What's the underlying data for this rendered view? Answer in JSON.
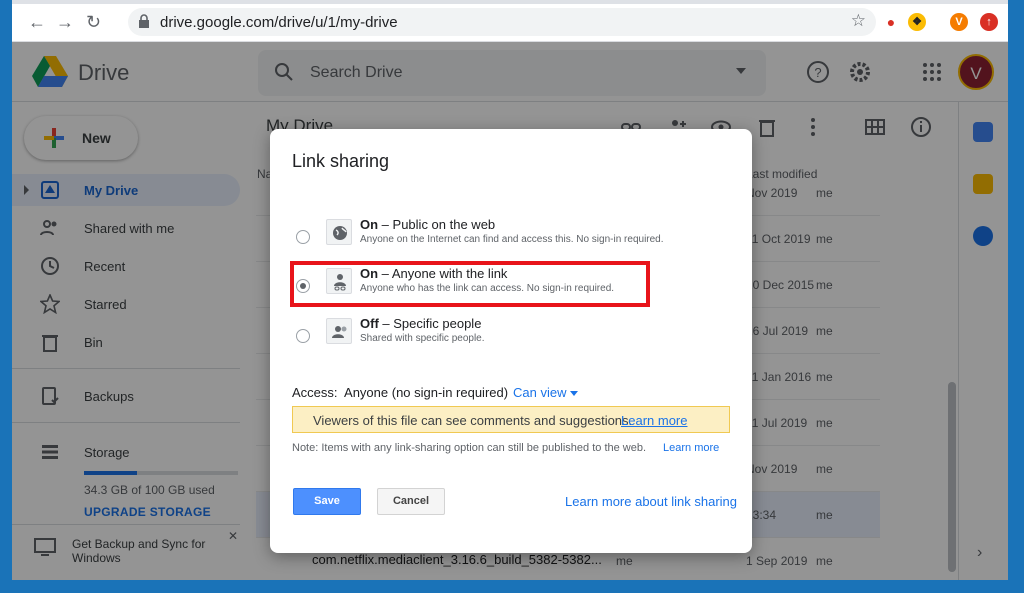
{
  "browser": {
    "url": "drive.google.com/drive/u/1/my-drive",
    "extensions": [
      "V"
    ]
  },
  "header": {
    "app_name": "Drive",
    "search_placeholder": "Search Drive",
    "avatar_letter": "V"
  },
  "sidebar": {
    "new_label": "New",
    "items": [
      {
        "label": "My Drive",
        "icon": "my-drive-icon",
        "active": true
      },
      {
        "label": "Shared with me",
        "icon": "people-icon"
      },
      {
        "label": "Recent",
        "icon": "clock-icon"
      },
      {
        "label": "Starred",
        "icon": "star-icon"
      },
      {
        "label": "Bin",
        "icon": "trash-icon"
      },
      {
        "label": "Backups",
        "icon": "backup-icon"
      },
      {
        "label": "Storage",
        "icon": "storage-icon"
      }
    ],
    "storage_used_fraction": 0.343,
    "storage_text": "34.3 GB of 100 GB used",
    "upgrade_label": "UPGRADE STORAGE",
    "backup_sync_label": "Get Backup and Sync for Windows"
  },
  "main": {
    "breadcrumb": "My Drive",
    "col_name": "Na",
    "col_modified": "Last modified",
    "rows": [
      {
        "date": "Nov 2019",
        "owner": "me"
      },
      {
        "date": "11 Oct 2019",
        "owner": "me"
      },
      {
        "date": "10 Dec 2015",
        "owner": "me"
      },
      {
        "date": "16 Jul 2019",
        "owner": "me"
      },
      {
        "date": "11 Jan 2016",
        "owner": "me"
      },
      {
        "date": "11 Jul 2019",
        "owner": "me"
      },
      {
        "date": "Nov 2019",
        "owner": "me"
      },
      {
        "date": "13:34",
        "owner": "me",
        "selected": true
      },
      {
        "name": "com.netflix.mediaclient_3.16.6_build_5382-5382...",
        "owner": "me",
        "date": "1 Sep 2019",
        "owner2": "me"
      }
    ]
  },
  "dialog": {
    "title": "Link sharing",
    "options": [
      {
        "state": "On",
        "label": "Public on the web",
        "desc": "Anyone on the Internet can find and access this. No sign-in required.",
        "icon": "globe-icon",
        "selected": false
      },
      {
        "state": "On",
        "label": "Anyone with the link",
        "desc": "Anyone who has the link can access. No sign-in required.",
        "icon": "link-person-icon",
        "selected": true
      },
      {
        "state": "Off",
        "label": "Specific people",
        "desc": "Shared with specific people.",
        "icon": "people-icon",
        "selected": false
      }
    ],
    "access_label": "Access:",
    "access_value": "Anyone (no sign-in required)",
    "can_view": "Can view",
    "notice_text": "Viewers of this file can see comments and suggestions.",
    "notice_link": "Learn more",
    "note_text": "Note: Items with any link-sharing option can still be published to the web.",
    "note_link": "Learn more",
    "save_label": "Save",
    "cancel_label": "Cancel",
    "learn_more_sharing": "Learn more about link sharing"
  },
  "colors": {
    "accent": "#1a73e8",
    "highlight": "#e8141a",
    "notice_bg": "#fcefc4"
  }
}
